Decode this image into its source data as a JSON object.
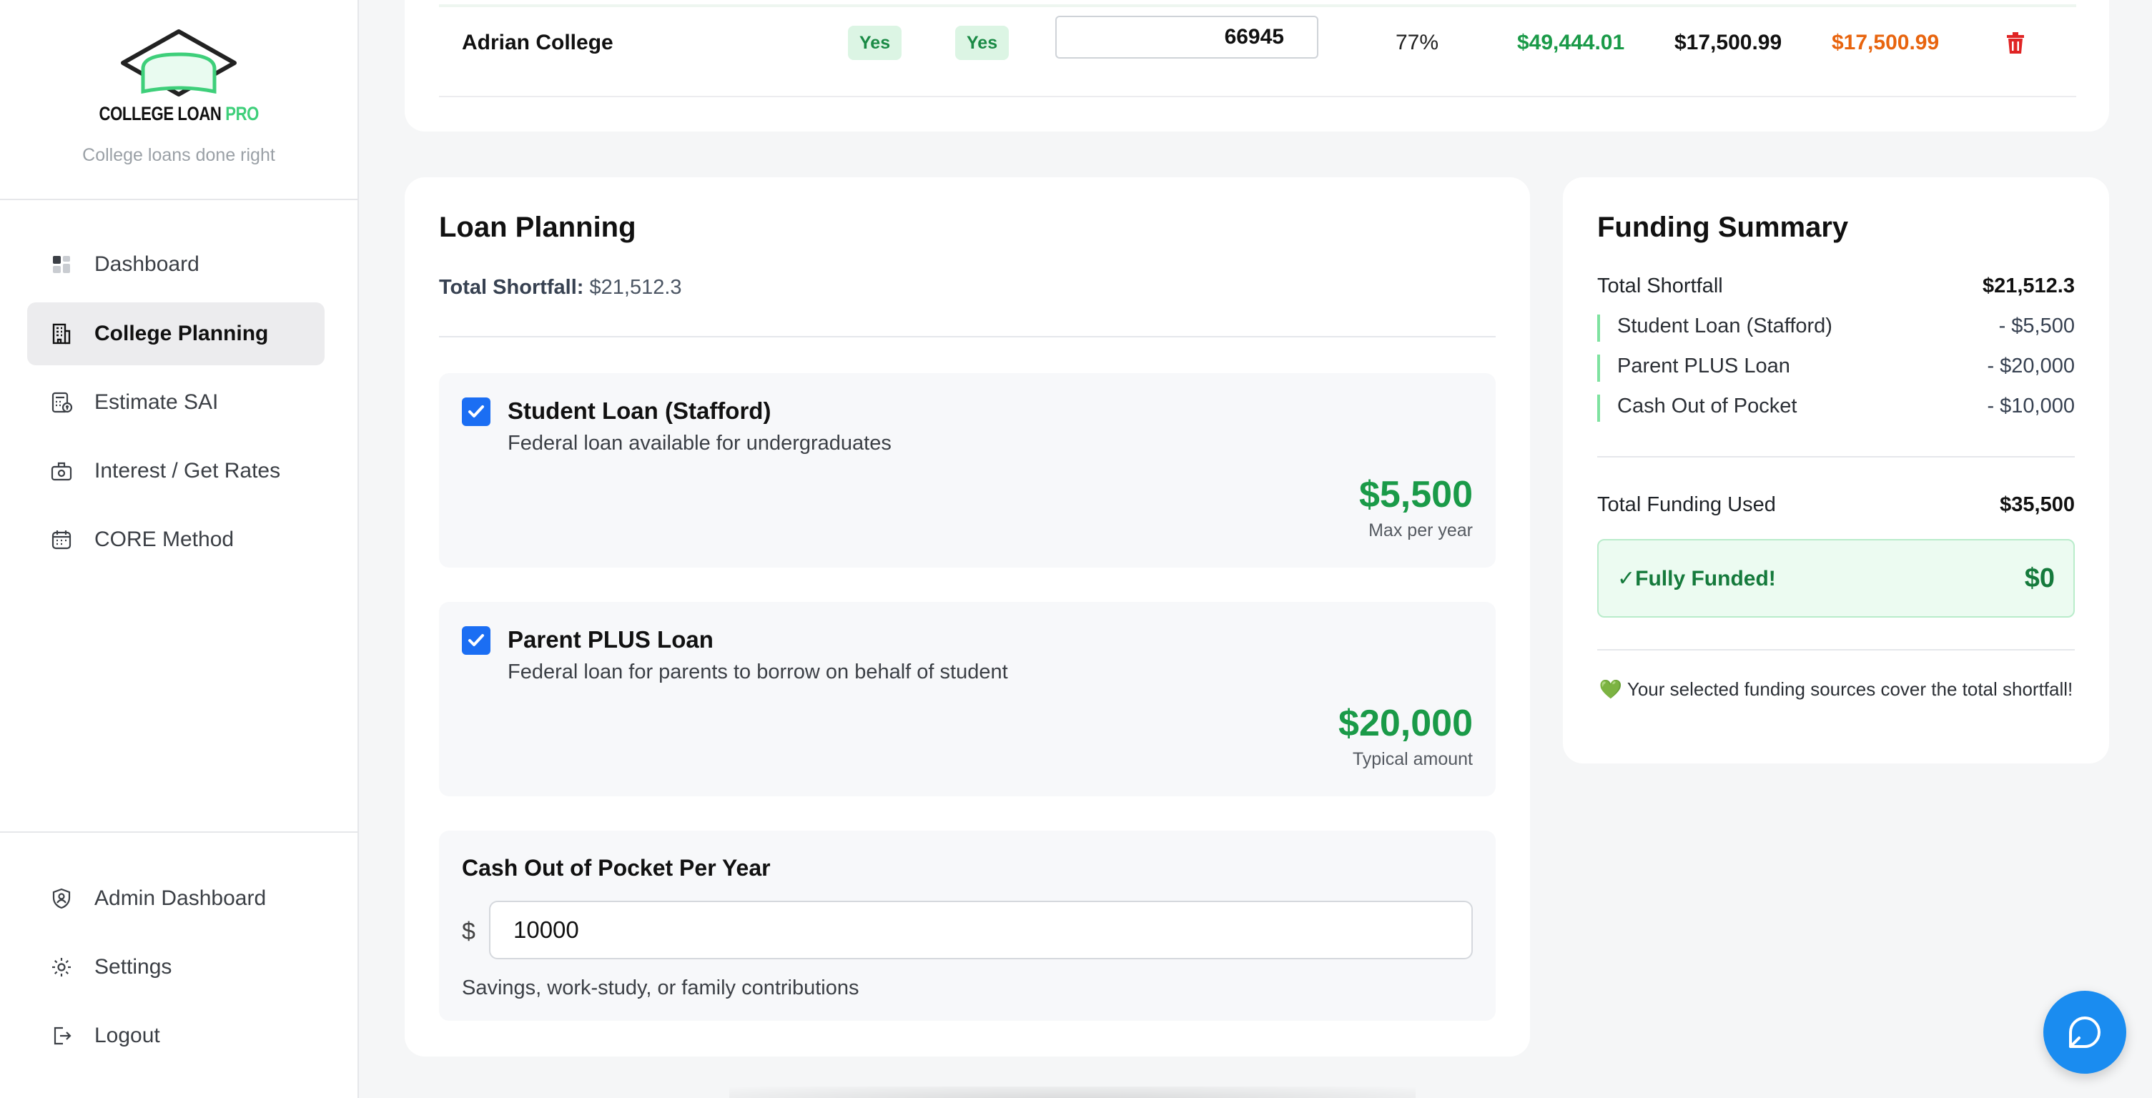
{
  "brand": {
    "name_main": "COLLEGE LOAN ",
    "name_accent": "PRO",
    "tagline": "College loans done right"
  },
  "nav": {
    "items": [
      {
        "label": "Dashboard",
        "icon": "dashboard-icon"
      },
      {
        "label": "College Planning",
        "icon": "building-icon",
        "active": true
      },
      {
        "label": "Estimate SAI",
        "icon": "calculator-icon"
      },
      {
        "label": "Interest / Get Rates",
        "icon": "money-icon"
      },
      {
        "label": "CORE Method",
        "icon": "calendar-icon"
      }
    ],
    "bottom": [
      {
        "label": "Admin Dashboard",
        "icon": "shield-user-icon"
      },
      {
        "label": "Settings",
        "icon": "gear-icon"
      },
      {
        "label": "Logout",
        "icon": "logout-icon"
      }
    ]
  },
  "college_row": {
    "name": "Adrian College",
    "badge1": "Yes",
    "badge2": "Yes",
    "efc_value": "66945",
    "percent": "77%",
    "amount_green": "$49,444.01",
    "amount_black": "$17,500.99",
    "amount_orange": "$17,500.99"
  },
  "loan_planning": {
    "title": "Loan Planning",
    "total_shortfall_label": "Total Shortfall:",
    "total_shortfall_value": "$21,512.3",
    "options": [
      {
        "title": "Student Loan (Stafford)",
        "description": "Federal loan available for undergraduates",
        "amount": "$5,500",
        "note": "Max per year",
        "checked": true
      },
      {
        "title": "Parent PLUS Loan",
        "description": "Federal loan for parents to borrow on behalf of student",
        "amount": "$20,000",
        "note": "Typical amount",
        "checked": true
      }
    ],
    "cash": {
      "title": "Cash Out of Pocket Per Year",
      "currency": "$",
      "value": "10000",
      "hint": "Savings, work-study, or family contributions"
    }
  },
  "funding_summary": {
    "title": "Funding Summary",
    "total_shortfall_label": "Total Shortfall",
    "total_shortfall_value": "$21,512.3",
    "items": [
      {
        "label": "Student Loan (Stafford)",
        "value": "- $5,500"
      },
      {
        "label": "Parent PLUS Loan",
        "value": "- $20,000"
      },
      {
        "label": "Cash Out of Pocket",
        "value": "- $10,000"
      }
    ],
    "total_funding_label": "Total Funding Used",
    "total_funding_value": "$35,500",
    "status_label": "✓Fully Funded!",
    "status_value": "$0",
    "note": "💚 Your selected funding sources cover the total shortfall!"
  },
  "colors": {
    "accent_green": "#1a9a48",
    "brand_green": "#3ecf7a",
    "checkbox_blue": "#1b6ef3",
    "orange": "#e8640e",
    "chat_blue": "#1a8cf0"
  }
}
